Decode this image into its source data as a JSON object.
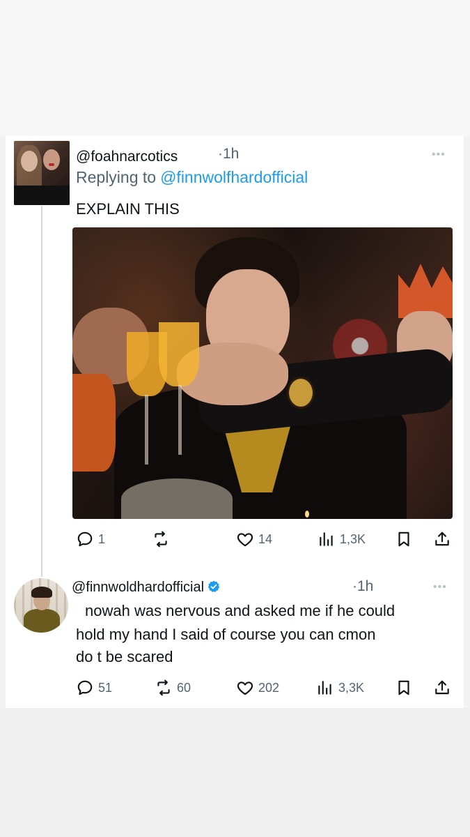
{
  "tweet1": {
    "handle": "@foahnarcotics",
    "time": "·1h",
    "more": "•••",
    "replying_prefix": "Replying to",
    "replying_to": "@finnwolfhardofficial",
    "text": "EXPLAIN THIS",
    "replies": "1",
    "retweets": "",
    "likes": "14",
    "views": "1,3K"
  },
  "tweet2": {
    "handle": "@finnwoldhardofficial",
    "time": "·1h",
    "more": "•••",
    "text_line1": "nowah  was nervous and asked me if he could",
    "text_line2": "hold my hand I said of course you can cmon",
    "text_line3": "do t be scared",
    "replies": "51",
    "retweets": "60",
    "likes": "202",
    "views": "3,3K"
  },
  "icons": {
    "reply": "reply-bubble-icon",
    "retweet": "retweet-icon",
    "like": "heart-icon",
    "views": "views-bar-chart-icon",
    "bookmark": "bookmark-icon",
    "share": "share-upload-icon",
    "verified": "verified-badge-icon"
  },
  "colors": {
    "link": "#1d9bf0",
    "secondary": "#536471",
    "text": "#0f1419",
    "verified": "#1d9bf0"
  }
}
